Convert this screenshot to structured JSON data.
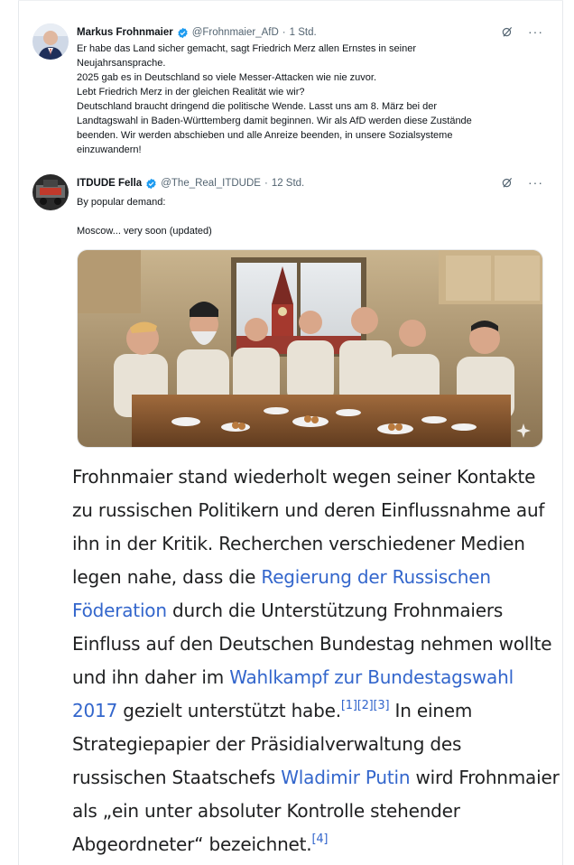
{
  "tweet1": {
    "name": "Markus Frohnmaier",
    "handle": "@Frohnmaier_AfD",
    "time": "1 Std.",
    "text": "Er habe das Land sicher gemacht, sagt Friedrich Merz allen Ernstes in seiner\nNeujahrsansprache.\n2025 gab es in Deutschland so viele Messer-Attacken wie nie zuvor.\nLebt Friedrich Merz in der gleichen Realität wie wir?\nDeutschland braucht dringend die politische Wende. Lasst uns am 8. März bei der\nLandtagswahl in Baden-Württemberg damit beginnen. Wir als AfD werden diese Zustände\nbeenden. Wir werden abschieben und alle Anreize beenden, in unsere Sozialsysteme\neinzuwandern!"
  },
  "tweet2": {
    "name": "ITDUDE Fella",
    "handle": "@The_Real_ITDUDE",
    "time": "12 Std.",
    "line1": "By popular demand:",
    "line2": "Moscow... very soon (updated)"
  },
  "wiki": {
    "p1": "Frohnmaier stand wiederholt wegen seiner Kontakte zu russischen Politikern und deren Einflussnahme auf ihn in der Kritik. Recherchen verschiedener Medien legen nahe, dass die ",
    "link1": "Regierung der Russischen Föderation",
    "p2": " durch die Unterstützung Frohnmaiers Einfluss auf den Deutschen Bundestag nehmen wollte und ihn daher im ",
    "link2": "Wahlkampf zur Bundestagswahl 2017",
    "p3": " gezielt unterstützt habe.",
    "ref1": "[1]",
    "ref2": "[2]",
    "ref3": "[3]",
    "p4": " In einem Strategiepapier der Präsidialverwaltung des russischen Staatschefs ",
    "link3": "Wladimir Putin",
    "p5": " wird Frohnmaier als „ein unter absoluter Kontrolle stehender Abgeordneter“ bezeichnet.",
    "ref4": "[4]"
  },
  "colors": {
    "link": "#3366cc",
    "verified": "#1d9bf0",
    "muted": "#536471"
  },
  "icons": [
    "verified-badge-icon",
    "grok-icon",
    "more-icon",
    "sparkle-icon"
  ]
}
